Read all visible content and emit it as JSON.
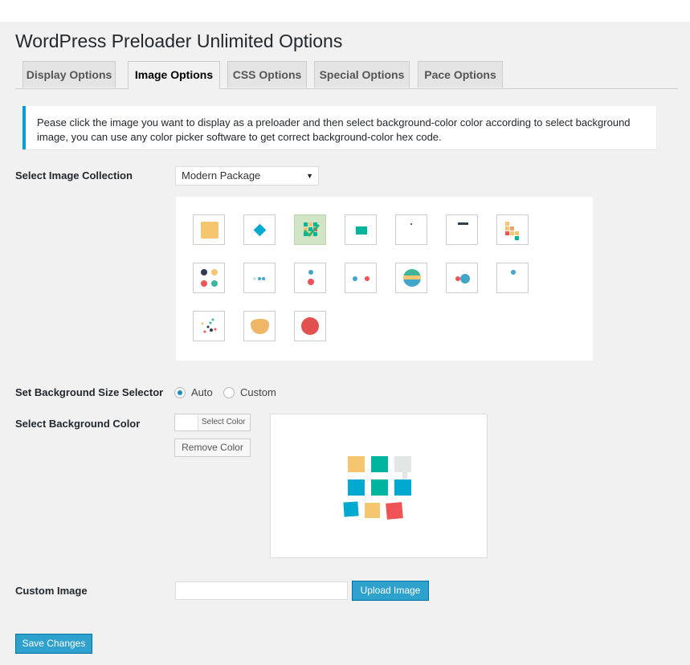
{
  "page": {
    "title": "WordPress Preloader Unlimited Options"
  },
  "tabs": [
    {
      "label": "Display Options",
      "active": false
    },
    {
      "label": "Image Options",
      "active": true
    },
    {
      "label": "CSS Options",
      "active": false
    },
    {
      "label": "Special Options",
      "active": false
    },
    {
      "label": "Pace Options",
      "active": false
    }
  ],
  "notice": {
    "text": "Pease click the image you want to display as a preloader and then select background-color color according to select background image, you can use any color picker software to get correct background-color hex code."
  },
  "collection": {
    "label": "Select Image Collection",
    "selected": "Modern Package",
    "arrow": "▼"
  },
  "gallery": {
    "selected_index": 2,
    "icons": [
      "yellow-square-icon",
      "teal-diamond-icon",
      "checkmark-grid-icon",
      "teal-rectangle-icon",
      "small-dot-icon",
      "dark-bar-icon",
      "orange-grid-icon",
      "four-dots-icon",
      "three-small-dots-icon",
      "stacked-dots-icon",
      "two-dots-icon",
      "striped-circle-icon",
      "dot-pair-icon",
      "single-blue-dot-icon",
      "scattered-dots-icon",
      "orange-blob-icon",
      "red-circle-icon"
    ]
  },
  "bg_size": {
    "label": "Set Background Size Selector",
    "options": [
      "Auto",
      "Custom"
    ],
    "selected": "Auto"
  },
  "bg_color": {
    "label": "Select Background Color",
    "select_button": "Select Color",
    "remove_button": "Remove Color"
  },
  "custom_image": {
    "label": "Custom Image",
    "value": "",
    "upload_button": "Upload Image"
  },
  "save_button": "Save Changes",
  "colors": {
    "accent_blue": "#2ea2cc",
    "yellow": "#f6c56f",
    "teal": "#00b5a0",
    "blue": "#00a9cf",
    "red": "#f05356",
    "light_gray": "#e2e7e6"
  }
}
